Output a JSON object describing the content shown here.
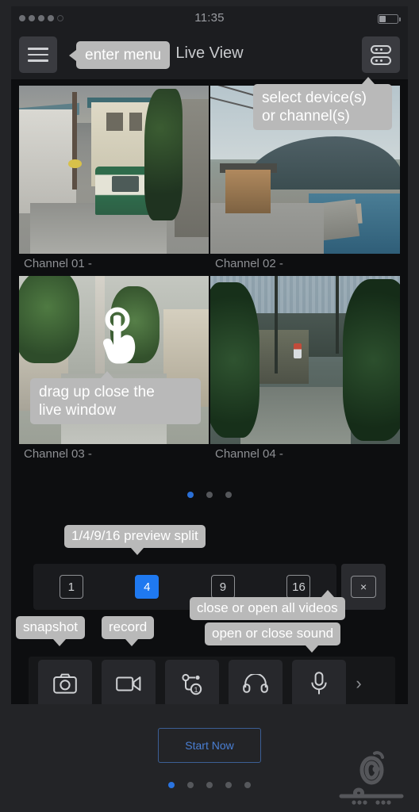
{
  "statusbar": {
    "clock": "11:35",
    "signal_dots": 5,
    "signal_filled": 4,
    "battery_level": 35
  },
  "header": {
    "title": "Live View",
    "menu_icon": "hamburger-icon",
    "device_icon": "device-list-icon"
  },
  "tooltips": {
    "enter_menu": "enter menu",
    "select_device": "select device(s)\nor channel(s)",
    "drag_up": "drag up close the\nlive window",
    "preview_split": "1/4/9/16 preview split",
    "close_all": "close or open all videos",
    "sound": "open or close sound",
    "snapshot": "snapshot",
    "record": "record"
  },
  "grid": {
    "channels": [
      {
        "label": "Channel 01 -",
        "scene": "alley-train"
      },
      {
        "label": "Channel 02 -",
        "scene": "coastal-road"
      },
      {
        "label": "Channel 03 -",
        "scene": "green-alley"
      },
      {
        "label": "Channel 04 -",
        "scene": "hillside-town"
      }
    ],
    "pager": {
      "count": 3,
      "active": 0
    }
  },
  "split": {
    "options": [
      "1",
      "4",
      "9",
      "16"
    ],
    "active": "4",
    "close_all_label": "×"
  },
  "toolbar": {
    "buttons": [
      {
        "name": "snapshot-button",
        "icon": "camera-icon"
      },
      {
        "name": "record-button",
        "icon": "video-camera-icon"
      },
      {
        "name": "stream-quality-button",
        "icon": "stream-branch-icon",
        "badge": "1"
      },
      {
        "name": "sound-button",
        "icon": "headphone-icon"
      },
      {
        "name": "talk-button",
        "icon": "microphone-icon"
      }
    ],
    "more_chevron": "›"
  },
  "footer": {
    "start_now": "Start Now",
    "pager": {
      "count": 5,
      "active": 0
    }
  },
  "colors": {
    "accent_blue": "#1f79f0",
    "tooltip_bg": "#b9b9b9",
    "app_bg": "#0d0e10",
    "chrome_bg": "#1c1d20",
    "frame_bg": "#232427"
  }
}
